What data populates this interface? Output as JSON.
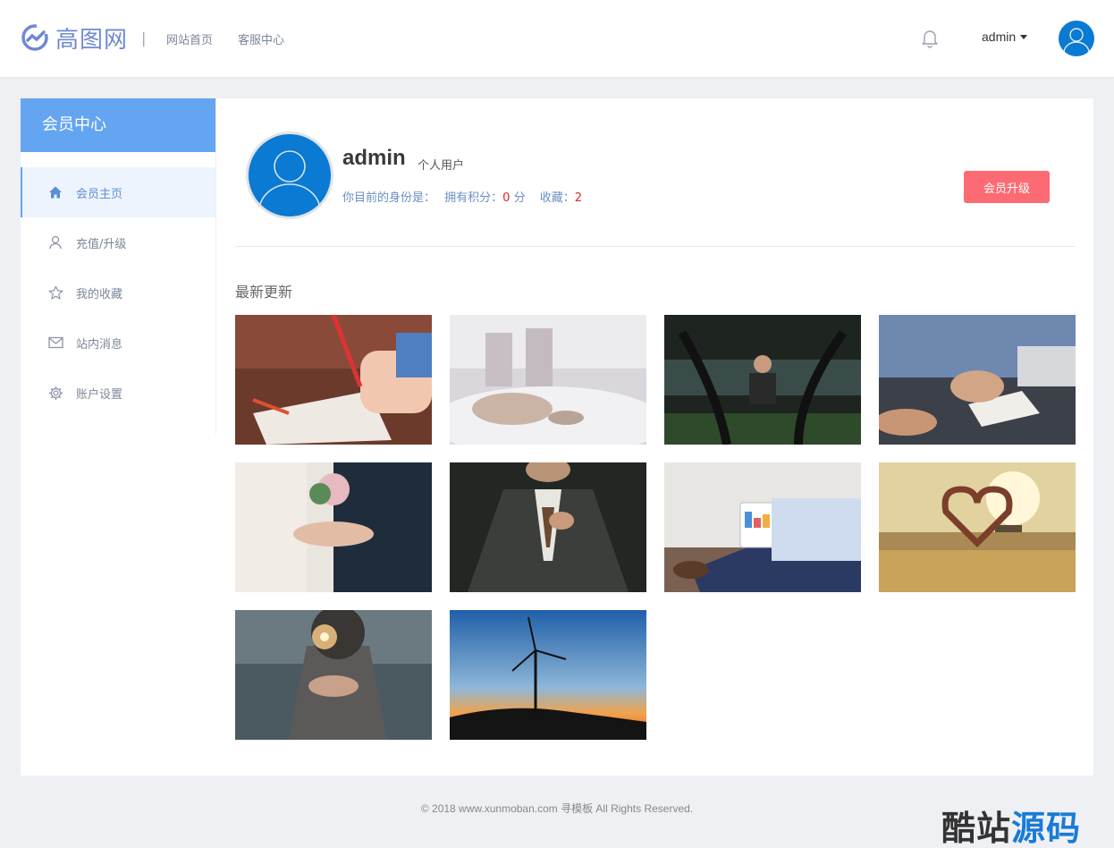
{
  "header": {
    "logo_text": "高图网",
    "divider": "|",
    "nav": [
      "网站首页",
      "客服中心"
    ],
    "username": "admin"
  },
  "sidebar": {
    "title": "会员中心",
    "items": [
      {
        "label": "会员主页",
        "icon": "home-icon",
        "active": true
      },
      {
        "label": "充值/升级",
        "icon": "user-icon",
        "active": false
      },
      {
        "label": "我的收藏",
        "icon": "star-icon",
        "active": false
      },
      {
        "label": "站内消息",
        "icon": "mail-icon",
        "active": false
      },
      {
        "label": "账户设置",
        "icon": "gear-icon",
        "active": false
      }
    ]
  },
  "profile": {
    "name": "admin",
    "type": "个人用户",
    "identity_label": "你目前的身份是：",
    "points_label": "拥有积分：",
    "points_value": "0",
    "points_unit": "分",
    "favorites_label": "收藏：",
    "favorites_value": "2",
    "upgrade_label": "会员升级"
  },
  "gallery": {
    "title": "最新更新",
    "images": [
      {
        "name": "kids-drawing-image"
      },
      {
        "name": "sleeping-woman-image"
      },
      {
        "name": "gym-training-image"
      },
      {
        "name": "man-writing-image"
      },
      {
        "name": "wedding-ring-image"
      },
      {
        "name": "suit-man-image"
      },
      {
        "name": "tablet-chart-image"
      },
      {
        "name": "beach-heart-image"
      },
      {
        "name": "sparkler-girl-image"
      },
      {
        "name": "wind-turbine-image"
      }
    ]
  },
  "footer": {
    "copyright": "© 2018 www.xunmoban.com 寻模板 All Rights Reserved."
  },
  "watermark": {
    "part1": "酷站",
    "part2": "源码"
  },
  "colors": {
    "accent": "#64a5f1",
    "upgrade": "#fc6a73",
    "avatar": "#0a7ad2",
    "highlight_number": "#e02424"
  }
}
